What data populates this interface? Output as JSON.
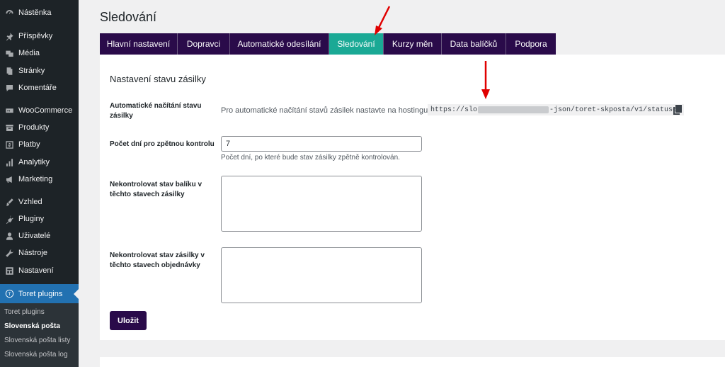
{
  "sidebar": {
    "items": [
      {
        "label": "Nástěnka",
        "icon": "dashboard-icon"
      },
      {
        "label": "Příspěvky",
        "icon": "pin-icon"
      },
      {
        "label": "Média",
        "icon": "media-icon"
      },
      {
        "label": "Stránky",
        "icon": "pages-icon"
      },
      {
        "label": "Komentáře",
        "icon": "comment-icon"
      },
      {
        "label": "WooCommerce",
        "icon": "woo-icon"
      },
      {
        "label": "Produkty",
        "icon": "archive-icon"
      },
      {
        "label": "Platby",
        "icon": "dollar-icon"
      },
      {
        "label": "Analytiky",
        "icon": "chart-icon"
      },
      {
        "label": "Marketing",
        "icon": "megaphone-icon"
      },
      {
        "label": "Vzhled",
        "icon": "brush-icon"
      },
      {
        "label": "Pluginy",
        "icon": "plugin-icon"
      },
      {
        "label": "Uživatelé",
        "icon": "users-icon"
      },
      {
        "label": "Nástroje",
        "icon": "wrench-icon"
      },
      {
        "label": "Nastavení",
        "icon": "settings-icon"
      },
      {
        "label": "Toret plugins",
        "icon": "toret-icon",
        "icon_letter": "T"
      }
    ],
    "submenu": [
      {
        "label": "Toret plugins"
      },
      {
        "label": "Slovenská pošta"
      },
      {
        "label": "Slovenská pošta listy"
      },
      {
        "label": "Slovenská pošta log"
      }
    ]
  },
  "page": {
    "title": "Sledování"
  },
  "tabs": [
    {
      "label": "Hlavní nastavení"
    },
    {
      "label": "Dopravci"
    },
    {
      "label": "Automatické odesílání"
    },
    {
      "label": "Sledování"
    },
    {
      "label": "Kurzy měn"
    },
    {
      "label": "Data balíčků"
    },
    {
      "label": "Podpora"
    }
  ],
  "form": {
    "section_title": "Nastavení stavu zásilky",
    "cron": {
      "label": "Automatické načítání stavu zásilky",
      "text": "Pro automatické načítání stavů zásilek nastavte na hostingu CRON:",
      "url_start": "https://slo",
      "url_end": "-json/toret-skposta/v1/statuses"
    },
    "days": {
      "label": "Počet dní pro zpětnou kontrolu",
      "value": "7",
      "description": "Počet dní, po které bude stav zásilky zpětně kontrolován."
    },
    "package_status": {
      "label": "Nekontrolovat stav balíku v těchto stavech zásilky"
    },
    "order_status": {
      "label": "Nekontrolovat stav zásilky v těchto stavech objednávky"
    },
    "save_label": "Uložit"
  },
  "colors": {
    "sidebar_bg": "#1d2327",
    "active_menu": "#2271b1",
    "tab_bg": "#2a0b4a",
    "tab_active": "#1aa995",
    "annotation_arrow": "#e00000"
  }
}
